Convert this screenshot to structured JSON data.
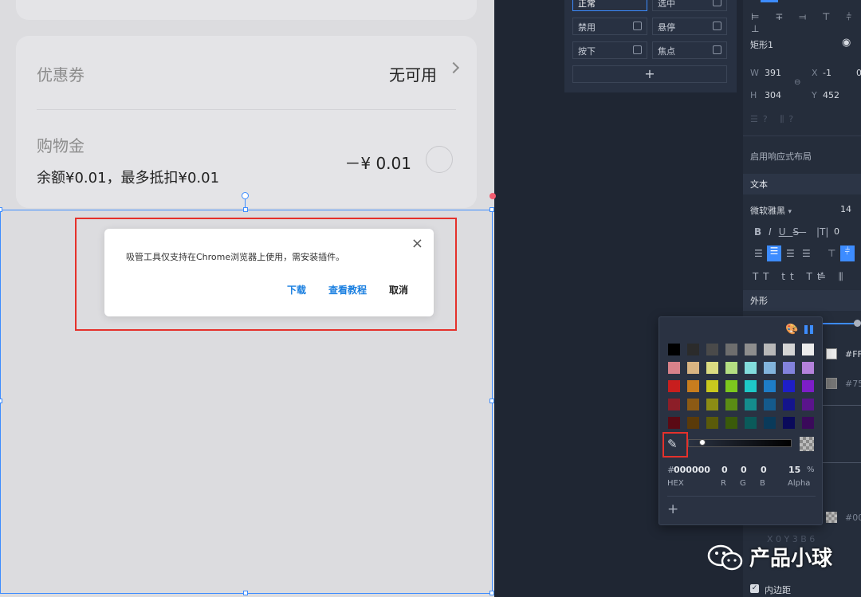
{
  "card": {
    "coupon_label": "优惠券",
    "coupon_value": "无可用",
    "gold_label": "购物金",
    "gold_desc": "余额¥0.01，最多抵扣¥0.01",
    "gold_amount": "－¥ 0.01"
  },
  "dialog": {
    "message": "吸管工具仅支持在Chrome浏览器上使用，需安装插件。",
    "close": "×",
    "download": "下载",
    "tutorial": "查看教程",
    "cancel": "取消"
  },
  "states": {
    "items": [
      {
        "label": "正常",
        "active": true
      },
      {
        "label": "选中"
      },
      {
        "label": "禁用"
      },
      {
        "label": "悬停"
      },
      {
        "label": "按下"
      },
      {
        "label": "焦点"
      }
    ],
    "add": "+"
  },
  "props": {
    "layer_name": "矩形1",
    "w_label": "W",
    "w_value": "391",
    "h_label": "H",
    "h_value": "304",
    "x_label": "X",
    "x_value": "-1",
    "y_label": "Y",
    "y_value": "452",
    "extra_value": "0",
    "responsive": "启用响应式布局",
    "text_section": "文本",
    "font_name": "微软雅黑",
    "font_size": "14",
    "letter_spacing": "0",
    "appearance_section": "外形",
    "fill_hex": "#FF",
    "stroke_hex": "#75",
    "shadow_hex": "#00",
    "shadow_xyb": "X 0    Y 3    B 6",
    "padding": "内边距"
  },
  "color_picker": {
    "hex": "000000",
    "r": "0",
    "g": "0",
    "b": "0",
    "alpha": "15",
    "percent": "%",
    "hex_label": "HEX",
    "r_label": "R",
    "g_label": "G",
    "b_label": "B",
    "alpha_label": "Alpha",
    "add": "+",
    "swatches": [
      [
        "#000000",
        "#2b2b2b",
        "#4a4a4a",
        "#6e6e6e",
        "#8e8e8e",
        "#b8b8b8",
        "#d4d4d4",
        "#ececec"
      ],
      [
        "#d8828a",
        "#d9b482",
        "#dcdc82",
        "#b4de82",
        "#82dcdc",
        "#82b4dc",
        "#8282dc",
        "#b482dc"
      ],
      [
        "#c81e1e",
        "#c87d1e",
        "#c8c81e",
        "#7dc81e",
        "#1ec8c8",
        "#1e7dc8",
        "#1e1ec8",
        "#7d1ec8"
      ],
      [
        "#8c1e28",
        "#8c5a14",
        "#8c8c14",
        "#5a8c14",
        "#148c8c",
        "#145a8c",
        "#14148c",
        "#5a148c"
      ],
      [
        "#5a0a14",
        "#5a3a0a",
        "#5a5a0a",
        "#3a5a0a",
        "#0a5a5a",
        "#0a3a5a",
        "#0a0a5a",
        "#3a0a5a"
      ]
    ]
  },
  "watermark": "产品小球"
}
